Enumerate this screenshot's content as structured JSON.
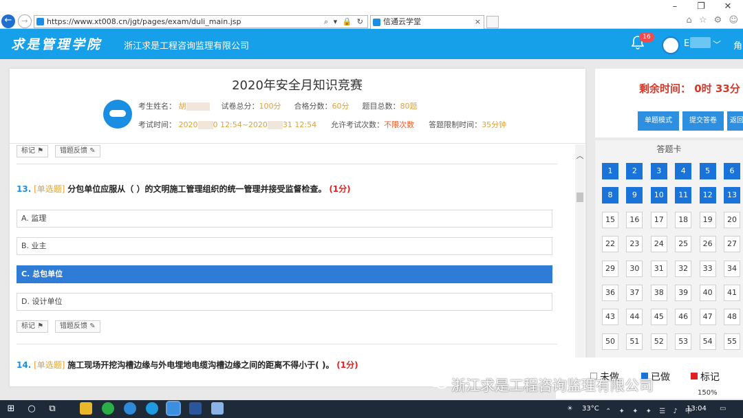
{
  "browser": {
    "url": "https://www.xt008.cn/jgt/pages/exam/duli_main.jsp",
    "address_tools": "⌕ ▾ 🔒 ↻",
    "tab_title": "信通云学堂"
  },
  "header": {
    "logo_text": "求是管理学院",
    "company": "浙江求是工程咨询监理有限公司",
    "notification_count": "16",
    "user_initial": "E",
    "role_text": "角"
  },
  "exam": {
    "title": "2020年安全月知识竞赛",
    "name_label": "考生姓名：",
    "name_value": "胡",
    "total_label": "试卷总分：",
    "total_value": "100分",
    "pass_label": "合格分数：",
    "pass_value": "60分",
    "count_label": "题目总数：",
    "count_value": "80题",
    "time_label": "考试时间：",
    "time_start": "2020",
    "time_mid": "0 12:54~2020",
    "time_end": "31 12:54",
    "attempts_label": "允许考试次数：",
    "attempts_value": "不限次数",
    "limit_label": "答题限制时间：",
    "limit_value": "35分钟"
  },
  "actions": {
    "mark": "标记",
    "feedback": "错题反馈"
  },
  "questions": [
    {
      "number": "13.",
      "type": "[单选题]",
      "text": "分包单位应服从（ ）的文明施工管理组织的统一管理并接受监督检查。",
      "score": "(1分)",
      "options": [
        "A. 监理",
        "B. 业主",
        "C. 总包单位",
        "D. 设计单位"
      ],
      "selected_index": 2
    },
    {
      "number": "14.",
      "type": "[单选题]",
      "text": "施工现场开挖沟槽边缘与外电埋地电缆沟槽边缘之间的距离不得小于( )。",
      "score": "(1分)"
    }
  ],
  "timer": {
    "label": "剩余时间：",
    "value": "0时 33分"
  },
  "panel_buttons": [
    "单题模式",
    "提交答卷",
    "返回"
  ],
  "answer_card": {
    "title": "答题卡",
    "cells": [
      "1",
      "2",
      "3",
      "4",
      "5",
      "6",
      "8",
      "9",
      "10",
      "11",
      "12",
      "13",
      "15",
      "16",
      "17",
      "18",
      "19",
      "20",
      "22",
      "23",
      "24",
      "25",
      "26",
      "27",
      "29",
      "30",
      "31",
      "32",
      "33",
      "34",
      "36",
      "37",
      "38",
      "39",
      "40",
      "41",
      "43",
      "44",
      "45",
      "46",
      "47",
      "48",
      "50",
      "51",
      "52",
      "53",
      "54",
      "55"
    ],
    "answered": [
      "1",
      "2",
      "3",
      "4",
      "5",
      "6",
      "8",
      "9",
      "10",
      "11",
      "12",
      "13"
    ]
  },
  "legend": {
    "undone": "未做",
    "done": "已做",
    "marked": "标记"
  },
  "zoom": "150%",
  "watermark": "浙江求是工程咨询监理有限公司",
  "taskbar": {
    "temperature": "33°C",
    "time": "13:04"
  },
  "colors": {
    "header_blue": "#16a0ea",
    "selected_option": "#2f7cd6",
    "answered_cell": "#1a73d9",
    "timer_red": "#d23a2a",
    "question_type": "#f0a020"
  }
}
